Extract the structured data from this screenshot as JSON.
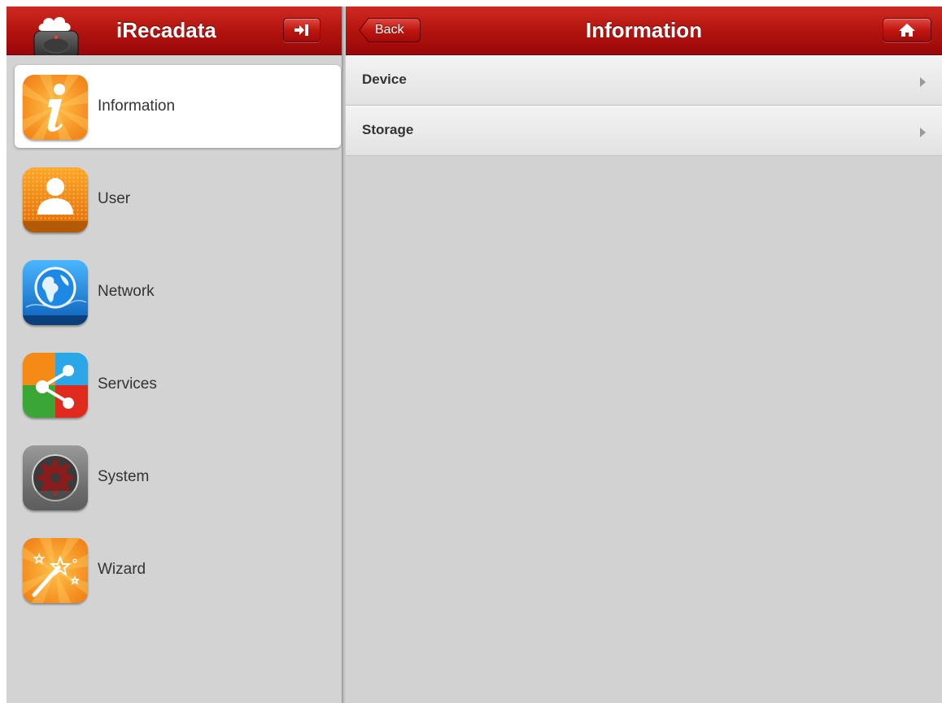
{
  "left_header": {
    "title": "iRecadata",
    "logo_icon": "cloud-device-icon",
    "logout_icon": "logout-arrow-icon"
  },
  "right_header": {
    "title": "Information",
    "back_label": "Back",
    "home_icon": "home-icon"
  },
  "nav": {
    "items": [
      {
        "label": "Information",
        "icon": "info-icon",
        "active": true
      },
      {
        "label": "User",
        "icon": "user-icon",
        "active": false
      },
      {
        "label": "Network",
        "icon": "globe-icon",
        "active": false
      },
      {
        "label": "Services",
        "icon": "share-icon",
        "active": false
      },
      {
        "label": "System",
        "icon": "gear-icon",
        "active": false
      },
      {
        "label": "Wizard",
        "icon": "magic-wand-icon",
        "active": false
      }
    ]
  },
  "list": {
    "items": [
      {
        "label": "Device"
      },
      {
        "label": "Storage"
      }
    ]
  },
  "colors": {
    "header_red": "#b3140e",
    "pane_gray": "#d3d3d3",
    "accent_orange": "#f28c17"
  }
}
